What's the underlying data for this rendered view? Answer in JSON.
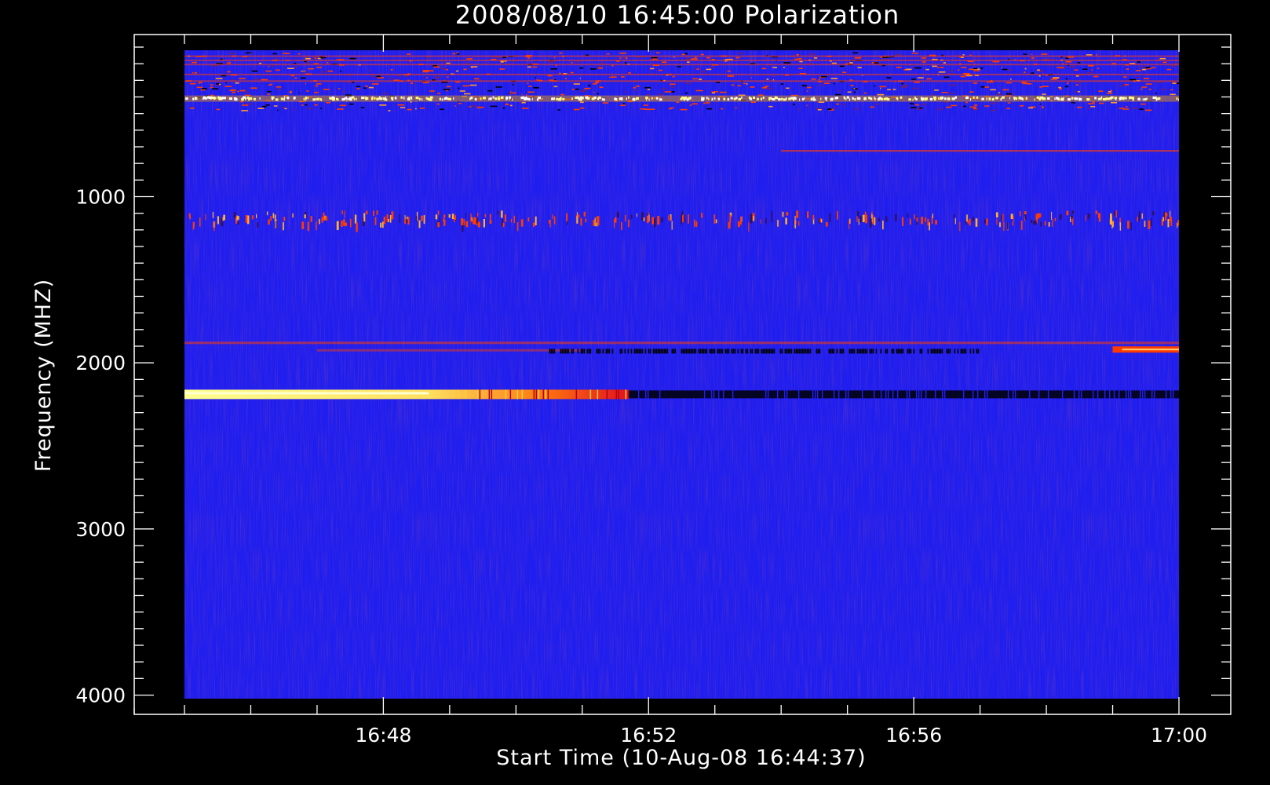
{
  "chart_data": {
    "type": "heatmap",
    "title": "2008/08/10 16:45:00 Polarization",
    "xlabel": "Start Time (10-Aug-08 16:44:37)",
    "ylabel": "Frequency (MHZ)",
    "x_ticks": [
      "16:48",
      "16:52",
      "16:56",
      "17:00"
    ],
    "x_tick_values_min": [
      48,
      52,
      56,
      60
    ],
    "xlim_min": [
      45,
      60
    ],
    "y_ticks": [
      1000,
      2000,
      3000,
      4000
    ],
    "ylim": [
      100,
      4000
    ],
    "y_inverted": true,
    "colors": {
      "background": "#000000",
      "field": "#1e1ef0",
      "black_feature": "#000000",
      "hot": "#ff3c00",
      "bright": "#ffff80"
    },
    "features": [
      {
        "kind": "rfi_band",
        "freq_start": 130,
        "freq_end": 480
      },
      {
        "kind": "bright_line",
        "freq": 410,
        "t_start": 45,
        "t_end": 60
      },
      {
        "kind": "spotty_line",
        "freq": 1120,
        "t_start": 45,
        "t_end": 60
      },
      {
        "kind": "red_line",
        "freq": 1880,
        "t_start": 45,
        "t_end": 60
      },
      {
        "kind": "black_line",
        "freq": 1930,
        "t_start": 50.5,
        "t_end": 57
      },
      {
        "kind": "red_patch",
        "freq": 1920,
        "t_start": 59,
        "t_end": 60
      },
      {
        "kind": "emission_line",
        "freq": 2190,
        "t_start": 45,
        "t_end": 51.7
      },
      {
        "kind": "absorption_line",
        "freq": 2190,
        "t_start": 51.7,
        "t_end": 60
      }
    ]
  }
}
